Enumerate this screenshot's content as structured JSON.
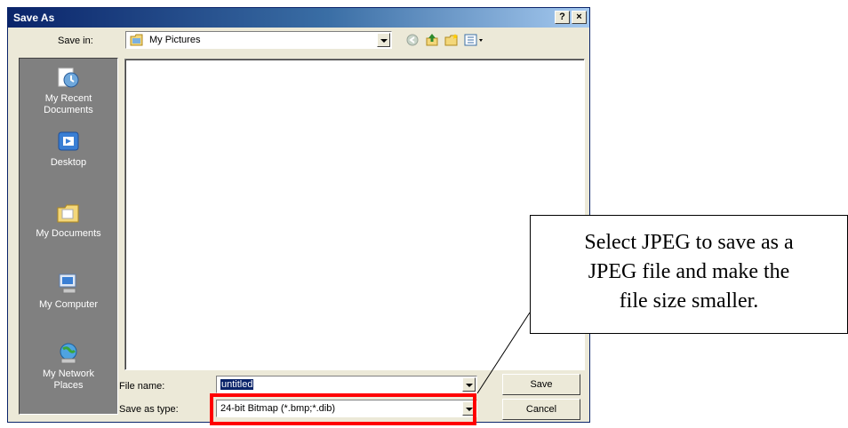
{
  "dialog": {
    "title": "Save As",
    "help_button": "?",
    "close_button": "×"
  },
  "toolbar": {
    "save_in_label": "Save in:",
    "save_in_value": "My Pictures",
    "icons": [
      "back-icon",
      "up-folder-icon",
      "new-folder-icon",
      "views-menu-icon"
    ]
  },
  "places": [
    {
      "icon": "recent-documents-icon",
      "line1": "My Recent",
      "line2": "Documents"
    },
    {
      "icon": "desktop-icon",
      "line1": "Desktop",
      "line2": ""
    },
    {
      "icon": "my-documents-icon",
      "line1": "My Documents",
      "line2": ""
    },
    {
      "icon": "my-computer-icon",
      "line1": "My Computer",
      "line2": ""
    },
    {
      "icon": "network-places-icon",
      "line1": "My Network",
      "line2": "Places"
    }
  ],
  "form": {
    "file_name_label": "File name:",
    "file_name_value": "untitled",
    "save_type_label": "Save as type:",
    "save_type_value": "24-bit Bitmap (*.bmp;*.dib)"
  },
  "buttons": {
    "save": "Save",
    "cancel": "Cancel"
  },
  "callout": {
    "line1": "Select JPEG to save as a",
    "line2": "JPEG file and make the",
    "line3": "file size smaller."
  },
  "colors": {
    "title_bar": "#0a246a",
    "dialog_face": "#ece9d8",
    "places_bar": "#808080",
    "highlight": "#ff0000"
  }
}
